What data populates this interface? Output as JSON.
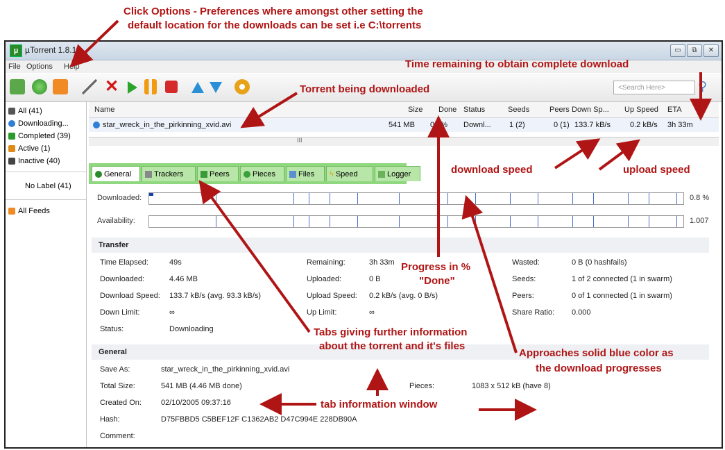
{
  "annotations": {
    "top_line1": "Click Options - Preferences where amongst other setting the",
    "top_line2": "default location for the downloads can be set i.e C:\\torrents",
    "time_remaining": "Time remaining to obtain complete download",
    "torrent_downloaded": "Torrent being downloaded",
    "download_speed": "download speed",
    "upload_speed": "upload speed",
    "progress_line1": "Progress in %",
    "progress_line2": "\"Done\"",
    "tabs_line1": "Tabs giving further information",
    "tabs_line2": "about the torrent and it's files",
    "approaches_line1": "Approaches solid blue color as",
    "approaches_line2": "the download progresses",
    "tab_info": "tab information window"
  },
  "window": {
    "title": "µTorrent 1.8.1",
    "menus": [
      "File",
      "Options",
      "Help"
    ],
    "search_placeholder": "<Search Here>"
  },
  "sidebar": {
    "items": [
      {
        "label": "All (41)",
        "color": "#555555"
      },
      {
        "label": "Downloading...",
        "color": "#2f7fd6"
      },
      {
        "label": "Completed (39)",
        "color": "#2a9a2a"
      },
      {
        "label": "Active (1)",
        "color": "#e08a1a"
      },
      {
        "label": "Inactive (40)",
        "color": "#444444"
      }
    ],
    "no_label": "No Label (41)",
    "feeds": "All Feeds"
  },
  "list": {
    "columns": [
      "Name",
      "Size",
      "Done",
      "Status",
      "Seeds",
      "Peers",
      "Down Sp...",
      "Up Speed",
      "ETA"
    ],
    "row": {
      "name": "star_wreck_in_the_pirkinning_xvid.avi",
      "size": "541 MB",
      "done": "0.8%",
      "status": "Downl...",
      "seeds": "1 (2)",
      "peers": "0 (1)",
      "down": "133.7 kB/s",
      "up": "0.2 kB/s",
      "eta": "3h 33m"
    },
    "scroll_marker": "III"
  },
  "tabs": [
    "General",
    "Trackers",
    "Peers",
    "Pieces",
    "Files",
    "Speed",
    "Logger"
  ],
  "progress": {
    "downloaded_label": "Downloaded:",
    "downloaded_value": "0.8 %",
    "availability_label": "Availability:",
    "availability_value": "1.007",
    "fraction": 0.008
  },
  "transfer": {
    "header": "Transfer",
    "col1": [
      {
        "k": "Time Elapsed:",
        "v": "49s"
      },
      {
        "k": "Downloaded:",
        "v": "4.46 MB"
      },
      {
        "k": "Download Speed:",
        "v": "133.7 kB/s (avg. 93.3 kB/s)"
      },
      {
        "k": "Down Limit:",
        "v": "∞"
      },
      {
        "k": "Status:",
        "v": "Downloading"
      }
    ],
    "col2": [
      {
        "k": "Remaining:",
        "v": "3h 33m"
      },
      {
        "k": "Uploaded:",
        "v": "0 B"
      },
      {
        "k": "Upload Speed:",
        "v": "0.2 kB/s (avg. 0 B/s)"
      },
      {
        "k": "Up Limit:",
        "v": "∞"
      }
    ],
    "col3": [
      {
        "k": "Wasted:",
        "v": "0 B (0 hashfails)"
      },
      {
        "k": "Seeds:",
        "v": "1 of 2 connected (1 in swarm)"
      },
      {
        "k": "Peers:",
        "v": "0 of 1 connected (1 in swarm)"
      },
      {
        "k": "Share Ratio:",
        "v": "0.000"
      }
    ]
  },
  "general": {
    "header": "General",
    "save_as_k": "Save As:",
    "save_as_v": "star_wreck_in_the_pirkinning_xvid.avi",
    "total_size_k": "Total Size:",
    "total_size_v": "541 MB (4.46 MB done)",
    "pieces_k": "Pieces:",
    "pieces_v": "1083 x 512 kB (have 8)",
    "created_k": "Created On:",
    "created_v": "02/10/2005 09:37:16",
    "hash_k": "Hash:",
    "hash_v": "D75FBBD5 C5BEF12F C1362AB2 D47C994E 228DB90A",
    "comment_k": "Comment:"
  }
}
